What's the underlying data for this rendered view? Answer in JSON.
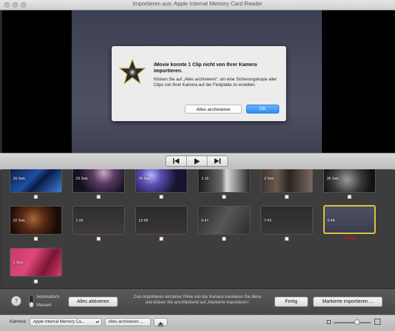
{
  "window": {
    "title": "Importieren aus: Apple Internal Memory Card Reader"
  },
  "dialog": {
    "title": "iMovie konnte 1 Clip nicht von Ihrer Kamera importieren.",
    "message": "Klicken Sie auf „Alles archivieren“, um eine Sicherungskopie aller Clips von Ihrer Kamera auf der Festplatte zu erstellen.",
    "archive_button": "Alles archivieren",
    "ok_button": "OK"
  },
  "clips": [
    {
      "label": "29 Sek."
    },
    {
      "label": "23 Sek."
    },
    {
      "label": "29 Sek."
    },
    {
      "label": "1:16"
    },
    {
      "label": "3 Sek."
    },
    {
      "label": "28 Sek."
    },
    {
      "label": "22 Sek."
    },
    {
      "label": "1:06"
    },
    {
      "label": "12:58"
    },
    {
      "label": "6:47"
    },
    {
      "label": "7:43"
    },
    {
      "label": "6:48",
      "status": "Fehler"
    },
    {
      "label": "1 Sek."
    }
  ],
  "bottom": {
    "help": "?",
    "switch_top": "Automatisch",
    "switch_bottom": "Manuell",
    "activate_all": "Alles aktivieren",
    "hint": "Zum Importieren einzelner Filme von der Kamera markieren Sie diese und klicken Sie anschließend auf „Markierte importieren“.",
    "done": "Fertig",
    "import_marked": "Markierte importieren ..."
  },
  "status": {
    "camera_label": "Kamera:",
    "camera_value": "Apple Internal Memory Ca...",
    "archive_all": "Alles archivieren ..."
  },
  "colors": {
    "ok_button": "#2d8cf5",
    "selected_border": "#e8c93b",
    "error_text": "#d01515"
  }
}
